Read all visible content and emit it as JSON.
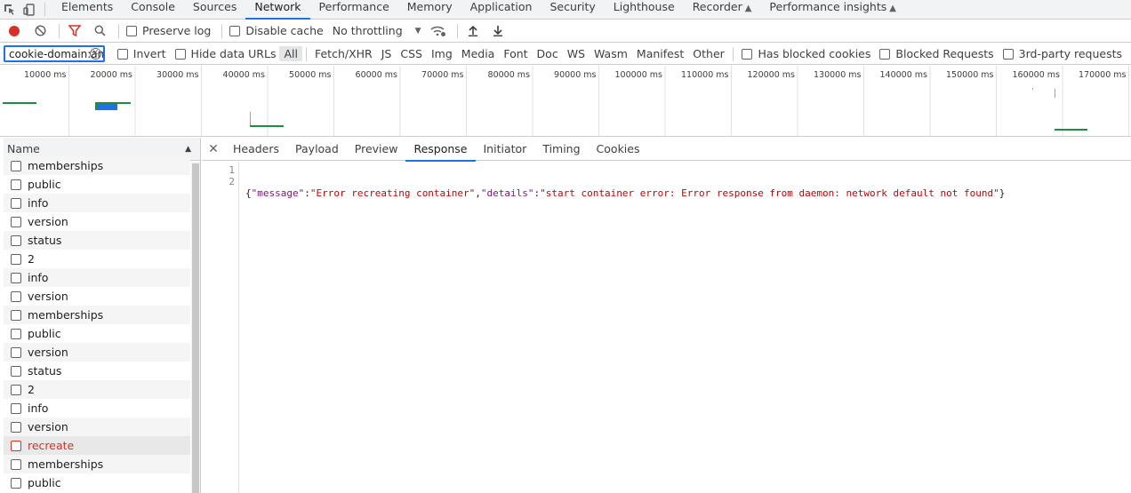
{
  "tabs": [
    {
      "label": "Elements"
    },
    {
      "label": "Console"
    },
    {
      "label": "Sources"
    },
    {
      "label": "Network",
      "active": true
    },
    {
      "label": "Performance"
    },
    {
      "label": "Memory"
    },
    {
      "label": "Application"
    },
    {
      "label": "Security"
    },
    {
      "label": "Lighthouse"
    },
    {
      "label": "Recorder",
      "experimental": true
    },
    {
      "label": "Performance insights",
      "experimental": true
    }
  ],
  "toolbar": {
    "preserve_log": "Preserve log",
    "disable_cache": "Disable cache",
    "throttling": "No throttling"
  },
  "filter": {
    "value": "cookie-domain:ansible.pre",
    "invert": "Invert",
    "hide_data_urls": "Hide data URLs",
    "types": [
      "All",
      "Fetch/XHR",
      "JS",
      "CSS",
      "Img",
      "Media",
      "Font",
      "Doc",
      "WS",
      "Wasm",
      "Manifest",
      "Other"
    ],
    "active_type": "All",
    "has_blocked_cookies": "Has blocked cookies",
    "blocked_requests": "Blocked Requests",
    "third_party": "3rd-party requests"
  },
  "overview": {
    "ticks": [
      "10000 ms",
      "20000 ms",
      "30000 ms",
      "40000 ms",
      "50000 ms",
      "60000 ms",
      "70000 ms",
      "80000 ms",
      "90000 ms",
      "100000 ms",
      "110000 ms",
      "120000 ms",
      "130000 ms",
      "140000 ms",
      "150000 ms",
      "160000 ms",
      "170000 ms"
    ],
    "colors": {
      "waiting": "#1e8e3e",
      "download": "#1a73e8",
      "stalled": "#9aa0a6"
    }
  },
  "requests": {
    "header": "Name",
    "items": [
      {
        "name": "memberships",
        "error": false
      },
      {
        "name": "public",
        "error": false
      },
      {
        "name": "info",
        "error": false
      },
      {
        "name": "version",
        "error": false
      },
      {
        "name": "status",
        "error": false
      },
      {
        "name": "2",
        "error": false
      },
      {
        "name": "info",
        "error": false
      },
      {
        "name": "version",
        "error": false
      },
      {
        "name": "memberships",
        "error": false
      },
      {
        "name": "public",
        "error": false
      },
      {
        "name": "version",
        "error": false
      },
      {
        "name": "status",
        "error": false
      },
      {
        "name": "2",
        "error": false
      },
      {
        "name": "info",
        "error": false
      },
      {
        "name": "version",
        "error": false
      },
      {
        "name": "recreate",
        "error": true
      },
      {
        "name": "memberships",
        "error": false
      },
      {
        "name": "public",
        "error": false
      }
    ]
  },
  "detail": {
    "tabs": [
      "Headers",
      "Payload",
      "Preview",
      "Response",
      "Initiator",
      "Timing",
      "Cookies"
    ],
    "active_tab": "Response",
    "line_numbers": [
      "1",
      "2"
    ],
    "response": {
      "k1": "\"message\"",
      "v1": "\"Error recreating container\"",
      "k2": "\"details\"",
      "v2": "\"start container error: Error response from daemon: network default not found\""
    }
  }
}
